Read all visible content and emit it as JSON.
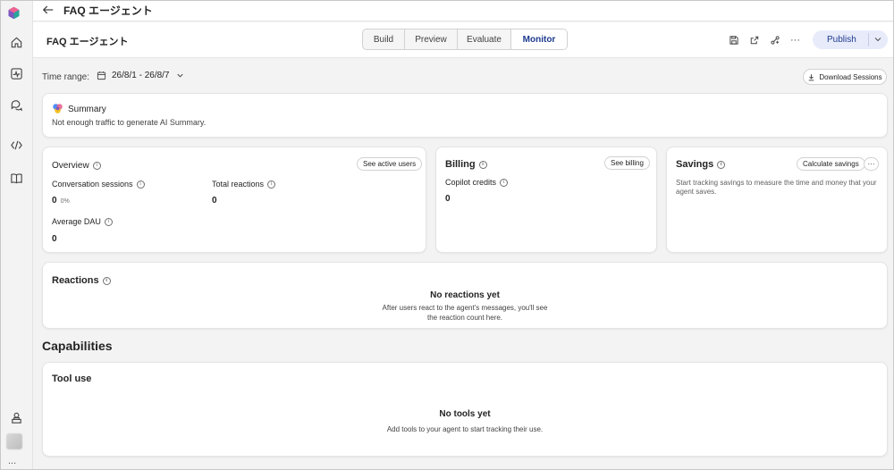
{
  "header": {
    "title": "FAQ エージェント"
  },
  "subbar": {
    "agent_name": "FAQ エージェント",
    "tabs": [
      {
        "label": "Build",
        "active": false
      },
      {
        "label": "Preview",
        "active": false
      },
      {
        "label": "Evaluate",
        "active": false
      },
      {
        "label": "Monitor",
        "active": true
      }
    ],
    "icons": [
      "save-icon",
      "share-icon",
      "connect-icon",
      "more-icon"
    ],
    "more_label": "···",
    "publish_label": "Publish"
  },
  "toolbar": {
    "time_range_label": "Time range:",
    "time_range_value": "26/8/1 - 26/8/7",
    "download_label": "Download Sessions"
  },
  "summary": {
    "title": "Summary",
    "text": "Not enough traffic to generate AI Summary."
  },
  "overview": {
    "title": "Overview",
    "button": "See active users",
    "conversation_sessions_label": "Conversation sessions",
    "conversation_sessions_value": "0",
    "conversation_sessions_change": "0%",
    "total_reactions_label": "Total reactions",
    "total_reactions_value": "0",
    "average_dau_label": "Average DAU",
    "average_dau_value": "0"
  },
  "billing": {
    "title": "Billing",
    "button": "See billing",
    "copilot_credits_label": "Copilot credits",
    "copilot_credits_value": "0"
  },
  "savings": {
    "title": "Savings",
    "button": "Calculate savings",
    "more_label": "···",
    "description": "Start tracking savings to measure the time and money that your agent saves."
  },
  "reactions": {
    "title": "Reactions",
    "empty_title": "No reactions yet",
    "empty_line1": "After users react to the agent's messages, you'll see",
    "empty_line2": "the reaction count here."
  },
  "capabilities": {
    "heading": "Capabilities",
    "tool_use_title": "Tool use",
    "empty_title": "No tools yet",
    "empty_desc": "Add tools to your agent to start tracking their use."
  },
  "rail": {
    "items": [
      "home-icon",
      "activity-icon",
      "chat-icon",
      "code-icon",
      "library-icon"
    ],
    "bottom_items": [
      "store-icon"
    ],
    "more_label": "..."
  },
  "colors": {
    "accent": "#1d3a8f",
    "publish_bg": "#e8ebfa",
    "background": "#f3f3f3"
  }
}
